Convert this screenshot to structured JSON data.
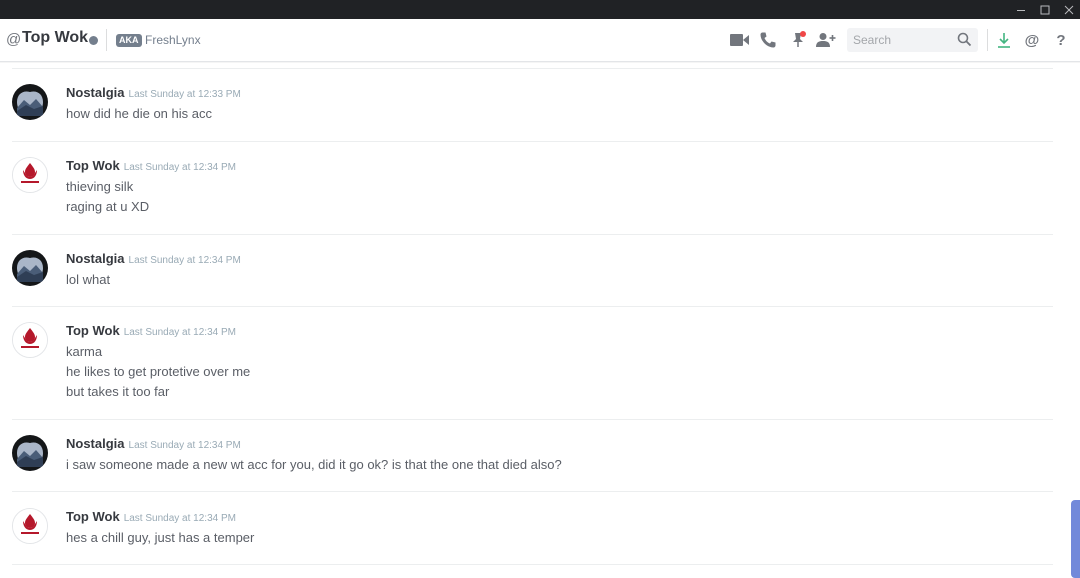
{
  "header": {
    "at_symbol": "@",
    "name": "Top Wok",
    "aka_badge": "AKA",
    "nickname": "FreshLynx",
    "search_placeholder": "Search",
    "help_label": "?",
    "mention_label": "@"
  },
  "icons": {
    "video": "video-call-icon",
    "call": "voice-call-icon",
    "pin": "pinned-messages-icon",
    "add_friend": "add-friend-icon",
    "search": "search-icon",
    "download": "download-icon",
    "mention": "mentions-icon",
    "help": "help-icon"
  },
  "colors": {
    "accent": "#7289da",
    "pin_badge": "#f04747",
    "download": "#43b581",
    "titlebar": "#202225"
  },
  "messages": [
    {
      "author": "Nostalgia",
      "timestamp": "Last Sunday at 12:33 PM",
      "lines": [
        "how did he die on his acc"
      ]
    },
    {
      "author": "Top Wok",
      "timestamp": "Last Sunday at 12:34 PM",
      "lines": [
        "thieving silk",
        "raging at u XD"
      ]
    },
    {
      "author": "Nostalgia",
      "timestamp": "Last Sunday at 12:34 PM",
      "lines": [
        "lol what"
      ]
    },
    {
      "author": "Top Wok",
      "timestamp": "Last Sunday at 12:34 PM",
      "lines": [
        "karma",
        "he likes to get protetive over me",
        "but takes it too far"
      ]
    },
    {
      "author": "Nostalgia",
      "timestamp": "Last Sunday at 12:34 PM",
      "lines": [
        "i saw someone made a new wt acc for you, did it go ok? is that the one that died also?"
      ]
    },
    {
      "author": "Top Wok",
      "timestamp": "Last Sunday at 12:34 PM",
      "lines": [
        "hes a chill guy, just has a temper"
      ]
    }
  ]
}
